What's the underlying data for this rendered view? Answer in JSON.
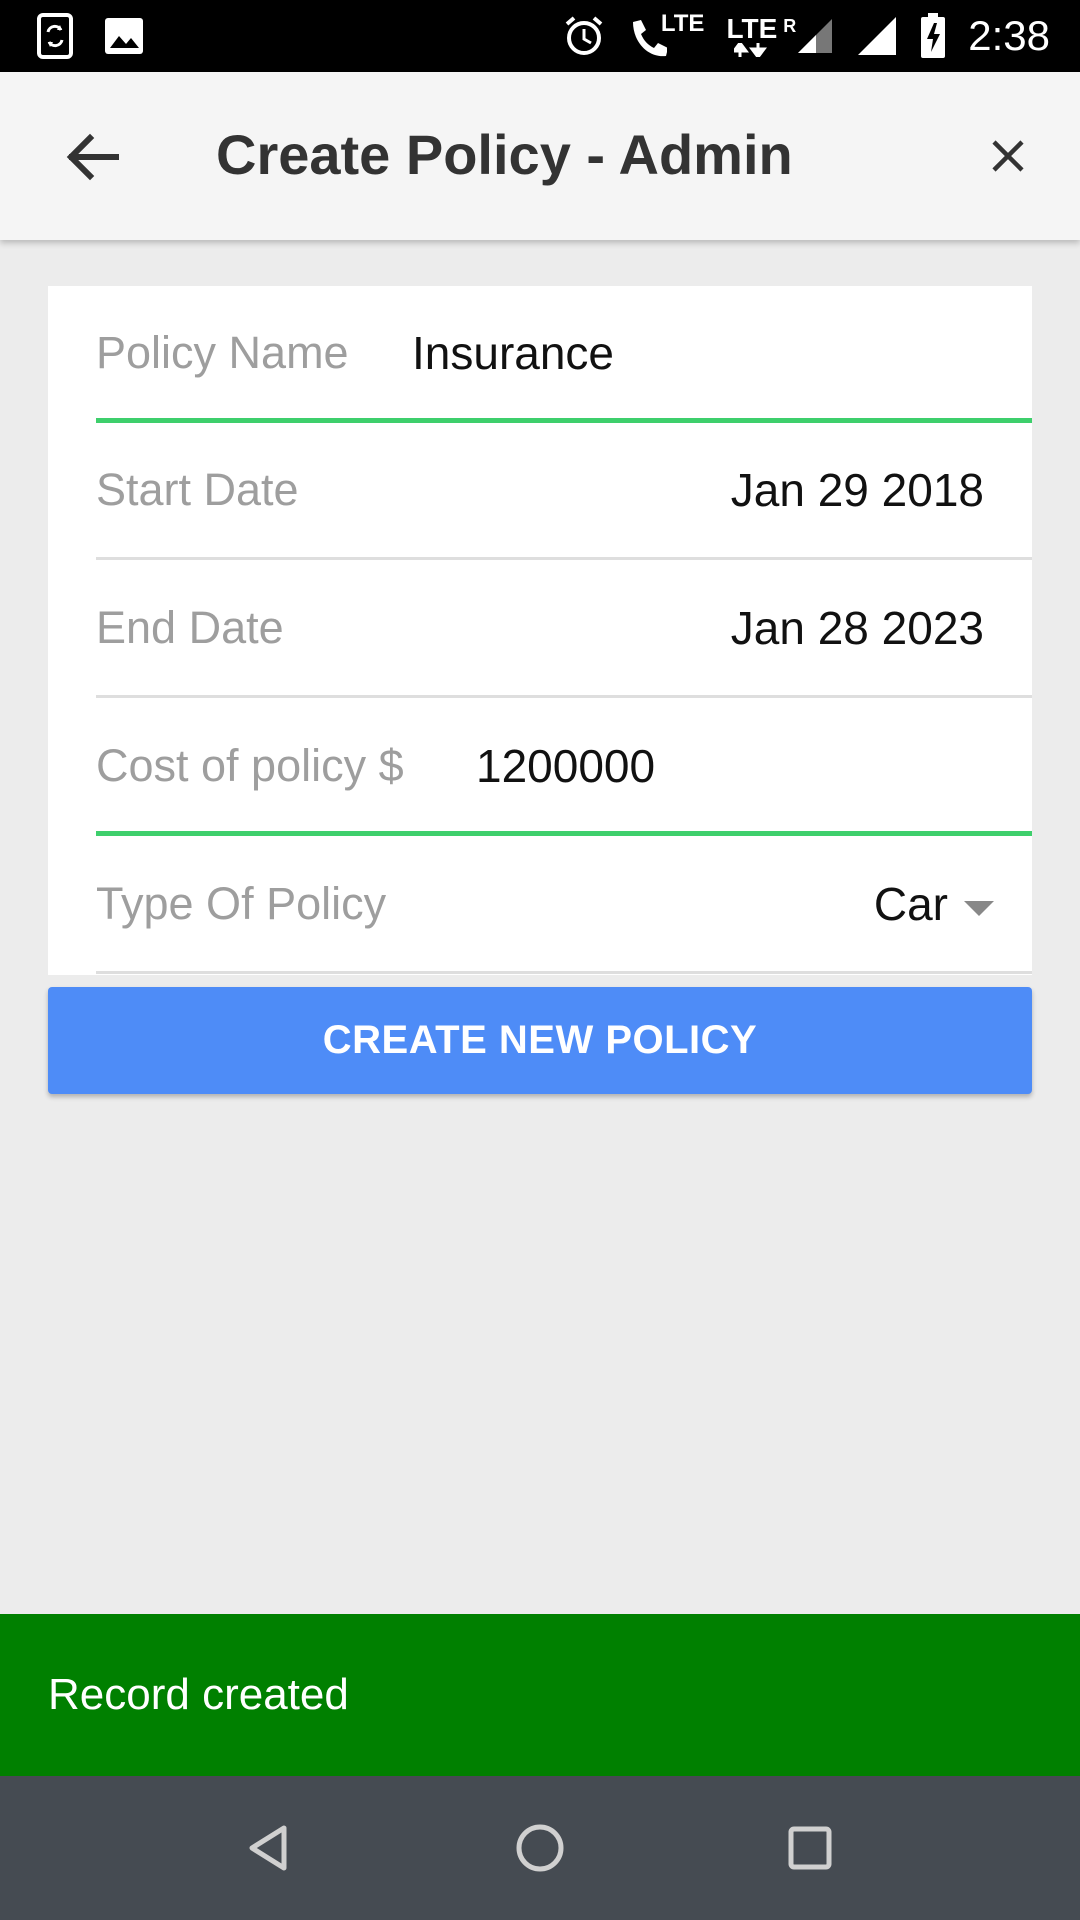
{
  "status_bar": {
    "time": "2:38",
    "lte_primary": "LTE",
    "lte_secondary": "LTE",
    "roaming": "R",
    "icons": [
      "sync-phone-icon",
      "image-icon",
      "alarm-icon",
      "wifi-call-icon",
      "signal-icon",
      "battery-charging-icon"
    ]
  },
  "app_bar": {
    "title": "Create Policy - Admin",
    "back_icon": "arrow-back-icon",
    "close_icon": "close-icon"
  },
  "form": {
    "policy_name": {
      "label": "Policy Name",
      "value": "Insurance"
    },
    "start_date": {
      "label": "Start Date",
      "value": "Jan 29 2018"
    },
    "end_date": {
      "label": "End Date",
      "value": "Jan 28 2023"
    },
    "cost": {
      "label": "Cost of policy $",
      "value": "1200000"
    },
    "policy_type": {
      "label": "Type Of Policy",
      "selected": "Car"
    }
  },
  "actions": {
    "create_label": "CREATE NEW POLICY"
  },
  "snackbar": {
    "message": "Record created",
    "color": "#008000"
  },
  "colors": {
    "accent_line": "#3ecf6c",
    "button": "#4e8cf7",
    "nav_bar": "#454b52"
  }
}
